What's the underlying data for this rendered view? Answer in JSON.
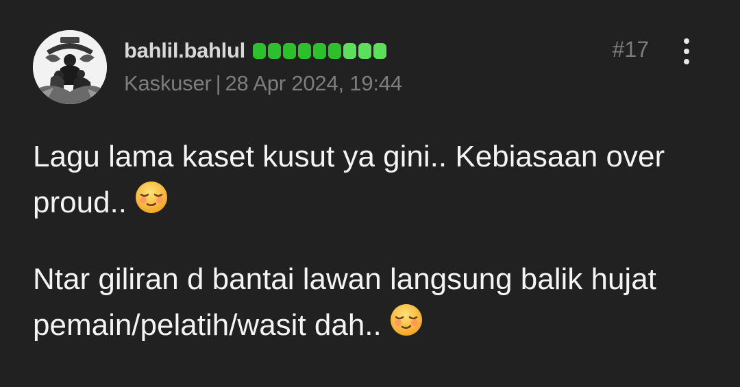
{
  "post": {
    "username": "bahlil.bahlul",
    "reputation": {
      "dots": [
        {
          "color": "#2cc12c"
        },
        {
          "color": "#2cc12c"
        },
        {
          "color": "#2cc12c"
        },
        {
          "color": "#2cc12c"
        },
        {
          "color": "#2cc12c"
        },
        {
          "color": "#2cc12c"
        },
        {
          "color": "#5ce05c"
        },
        {
          "color": "#5ce05c"
        },
        {
          "color": "#5ce05c"
        }
      ]
    },
    "user_title": "Kaskuser",
    "separator": "|",
    "date": "28 Apr 2024, 19:44",
    "post_number": "#17",
    "paragraphs": [
      {
        "text": "Lagu lama kaset kusut ya gini.. Kebiasaan over proud..",
        "emoji": "relieved-face-emoji"
      },
      {
        "text": "Ntar giliran d bantai lawan langsung balik hujat pemain/pelatih/wasit dah..",
        "emoji": "relieved-face-emoji"
      }
    ]
  },
  "icons": {
    "avatar": "avatar-image",
    "more": "vertical-dots-icon"
  },
  "colors": {
    "background": "#212121",
    "text": "#f4f4f4",
    "muted": "#7d7d7d",
    "username": "#d9d9d9"
  }
}
